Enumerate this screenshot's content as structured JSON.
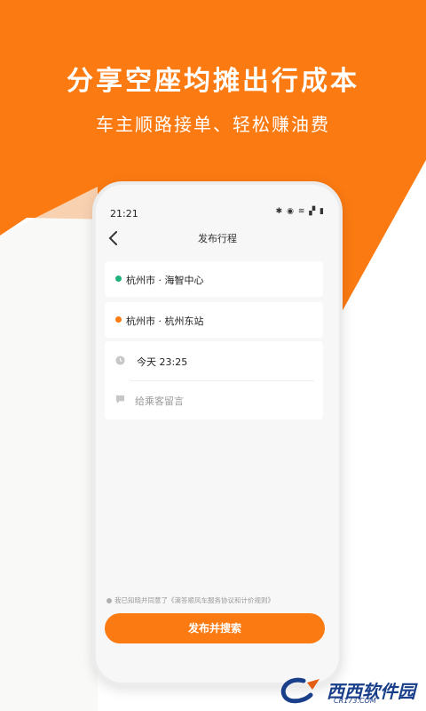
{
  "colors": {
    "accent": "#fb7a12",
    "start_dot": "#1fb27a",
    "end_dot": "#fb7a12"
  },
  "promo": {
    "headline": "分享空座均摊出行成本",
    "subline": "车主顺路接单、轻松赚油费"
  },
  "status_bar": {
    "time": "21:21",
    "icons": [
      "notifications-icon",
      "location-icon",
      "wifi-icon",
      "signal-icon",
      "battery-icon"
    ]
  },
  "nav": {
    "title": "发布行程",
    "back_icon": "chevron-left-icon"
  },
  "trip": {
    "origin": "杭州市 · 海智中心",
    "destination": "杭州市 · 杭州东站",
    "time": "今天 23:25",
    "message_placeholder": "给乘客留言"
  },
  "agreement": {
    "text": "我已知晓并同意了《滴答顺风车服务协议和计价规则》"
  },
  "submit": {
    "label": "发布并搜索"
  },
  "watermark": {
    "brand": "西西软件园",
    "domain": "CR173.COM"
  }
}
